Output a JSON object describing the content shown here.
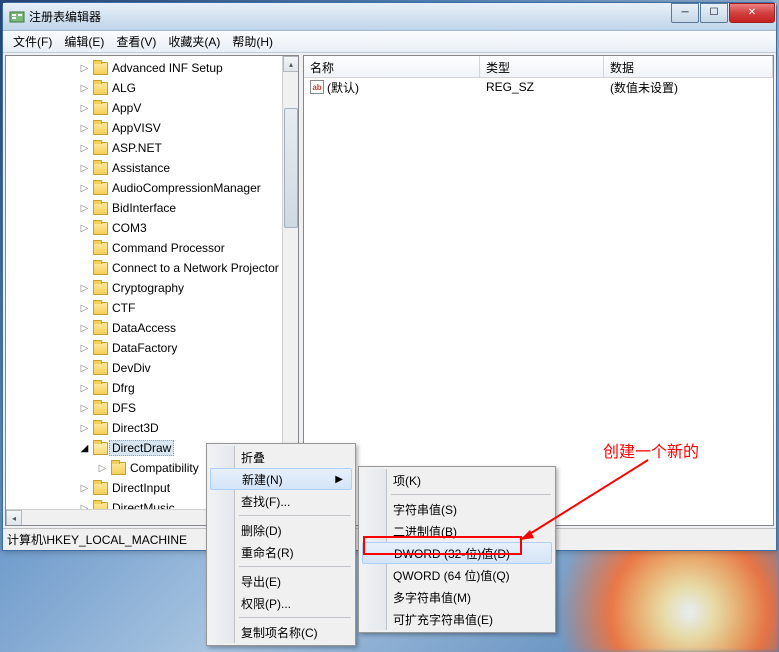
{
  "titlebar": {
    "title": "注册表编辑器"
  },
  "menubar": {
    "file": "文件(F)",
    "edit": "编辑(E)",
    "view": "查看(V)",
    "favorites": "收藏夹(A)",
    "help": "帮助(H)"
  },
  "tree": {
    "items": [
      {
        "label": "Advanced INF Setup",
        "depth": 4,
        "expander": "▷"
      },
      {
        "label": "ALG",
        "depth": 4,
        "expander": "▷"
      },
      {
        "label": "AppV",
        "depth": 4,
        "expander": "▷"
      },
      {
        "label": "AppVISV",
        "depth": 4,
        "expander": "▷"
      },
      {
        "label": "ASP.NET",
        "depth": 4,
        "expander": "▷"
      },
      {
        "label": "Assistance",
        "depth": 4,
        "expander": "▷"
      },
      {
        "label": "AudioCompressionManager",
        "depth": 4,
        "expander": "▷"
      },
      {
        "label": "BidInterface",
        "depth": 4,
        "expander": "▷"
      },
      {
        "label": "COM3",
        "depth": 4,
        "expander": "▷"
      },
      {
        "label": "Command Processor",
        "depth": 4,
        "expander": ""
      },
      {
        "label": "Connect to a Network Projector",
        "depth": 4,
        "expander": ""
      },
      {
        "label": "Cryptography",
        "depth": 4,
        "expander": "▷"
      },
      {
        "label": "CTF",
        "depth": 4,
        "expander": "▷"
      },
      {
        "label": "DataAccess",
        "depth": 4,
        "expander": "▷"
      },
      {
        "label": "DataFactory",
        "depth": 4,
        "expander": "▷"
      },
      {
        "label": "DevDiv",
        "depth": 4,
        "expander": "▷"
      },
      {
        "label": "Dfrg",
        "depth": 4,
        "expander": "▷"
      },
      {
        "label": "DFS",
        "depth": 4,
        "expander": "▷"
      },
      {
        "label": "Direct3D",
        "depth": 4,
        "expander": "▷"
      },
      {
        "label": "DirectDraw",
        "depth": 4,
        "expander": "◢",
        "open": true,
        "selected": true
      },
      {
        "label": "Compatibility",
        "depth": 5,
        "expander": "▷"
      },
      {
        "label": "DirectInput",
        "depth": 4,
        "expander": "▷"
      },
      {
        "label": "DirectMusic",
        "depth": 4,
        "expander": "▷"
      }
    ]
  },
  "list": {
    "col_name": "名称",
    "col_type": "类型",
    "col_data": "数据",
    "rows": [
      {
        "name": "(默认)",
        "type": "REG_SZ",
        "data": "(数值未设置)"
      }
    ]
  },
  "statusbar": {
    "path": "计算机\\HKEY_LOCAL_MACHINE"
  },
  "ctxmenu1": {
    "collapse": "折叠",
    "new": "新建(N)",
    "find": "查找(F)...",
    "delete": "删除(D)",
    "rename": "重命名(R)",
    "export": "导出(E)",
    "perm": "权限(P)...",
    "copyname": "复制项名称(C)"
  },
  "ctxmenu2": {
    "key": "项(K)",
    "string": "字符串值(S)",
    "binary": "二进制值(B)",
    "dword": "DWORD (32-位)值(D)",
    "qword": "QWORD (64 位)值(Q)",
    "multi": "多字符串值(M)",
    "expand": "可扩充字符串值(E)"
  },
  "annotation": {
    "text": "创建一个新的"
  }
}
